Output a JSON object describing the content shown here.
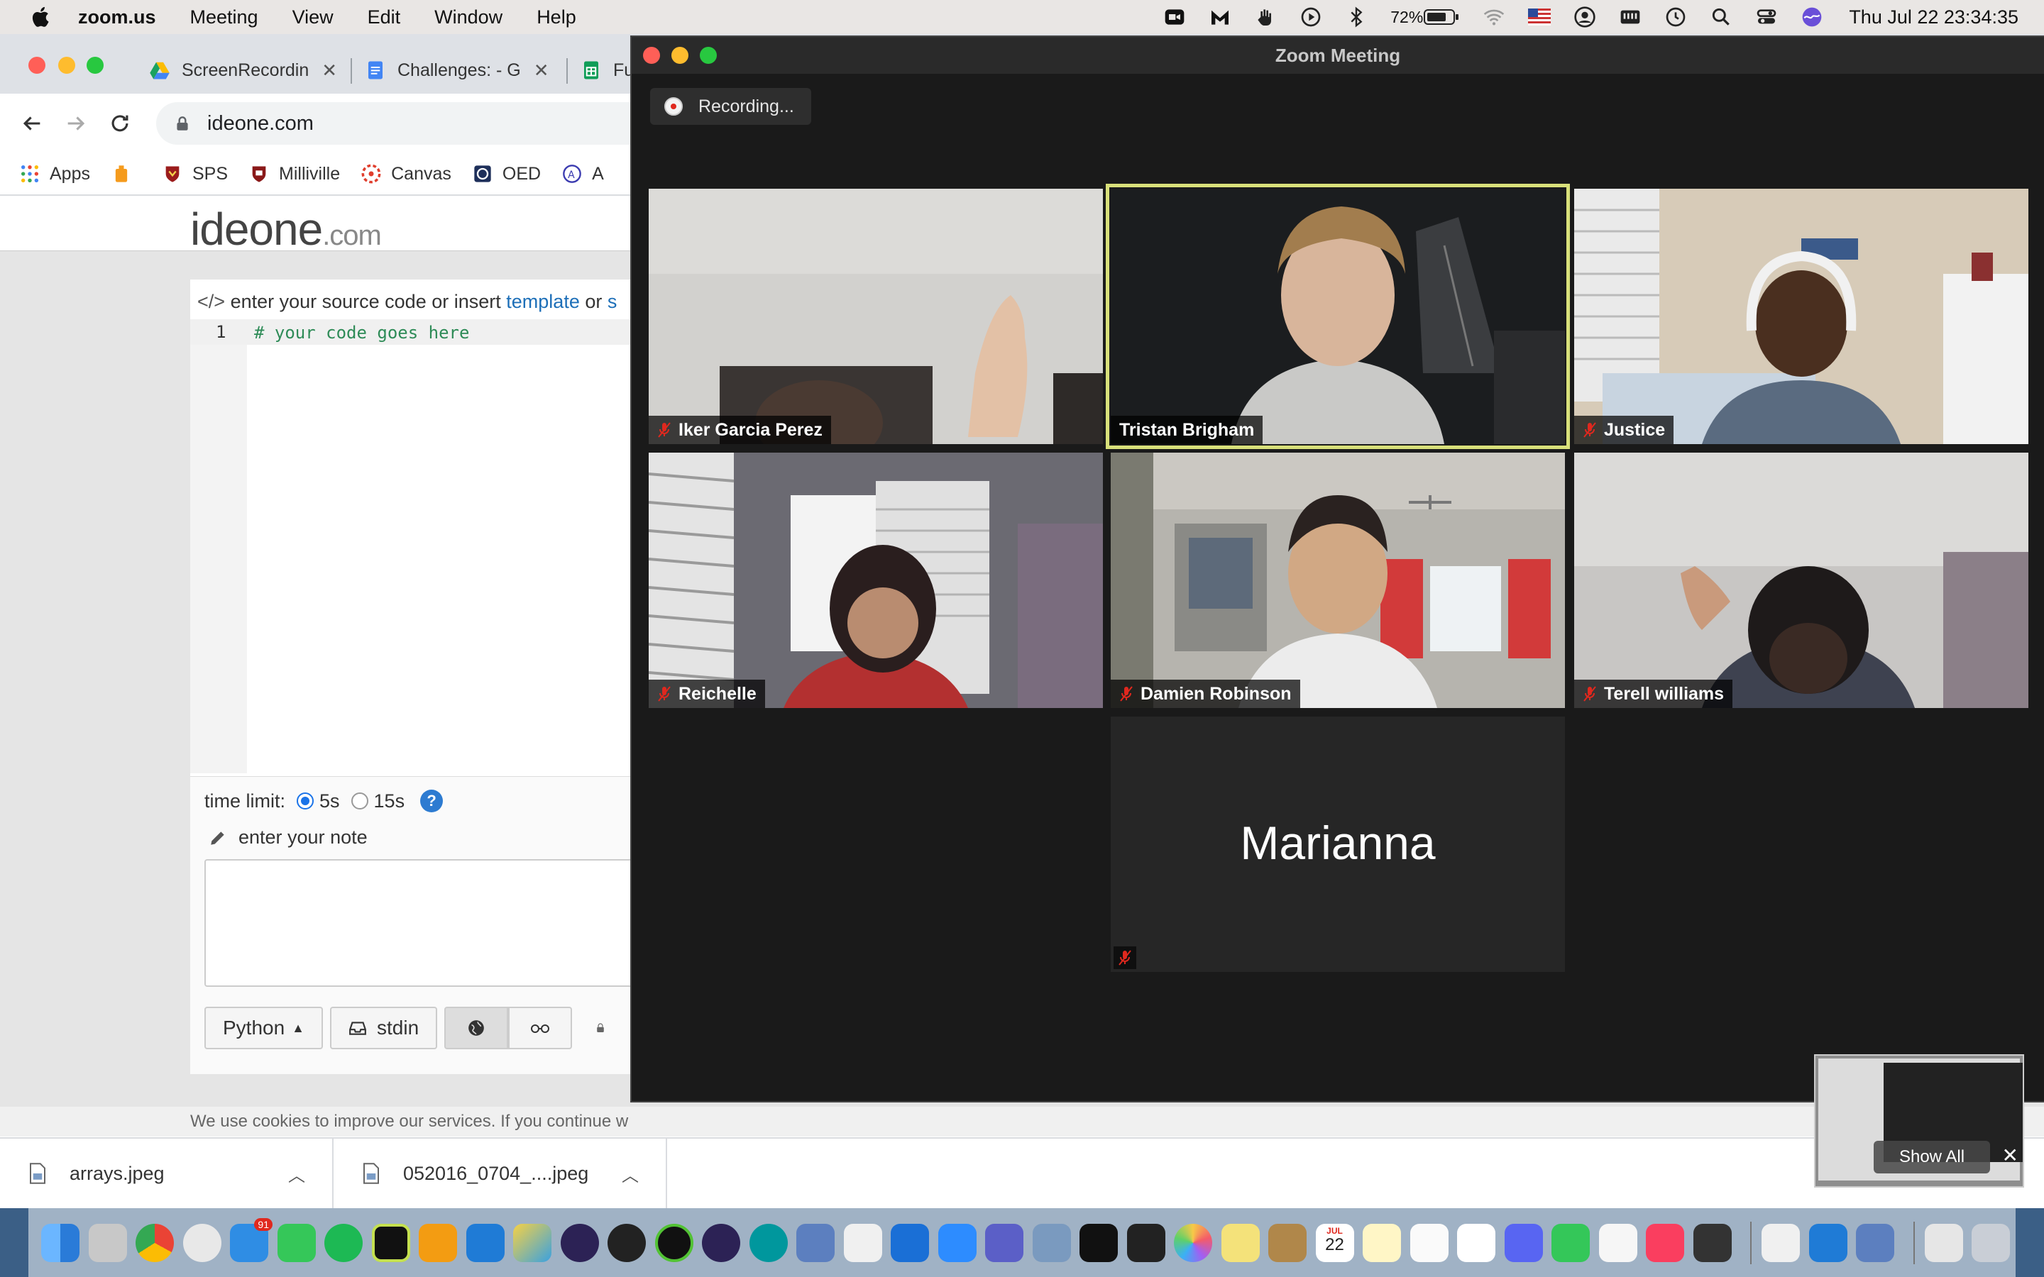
{
  "menubar": {
    "app_name": "zoom.us",
    "menus": [
      "Meeting",
      "View",
      "Edit",
      "Window",
      "Help"
    ],
    "battery_percent": "72%",
    "clock": "Thu Jul 22  23:34:35"
  },
  "browser": {
    "tabs": [
      {
        "title": "ScreenRecordin",
        "icon": "google-drive-icon"
      },
      {
        "title": "Challenges: - G",
        "icon": "google-docs-icon"
      },
      {
        "title": "Fu",
        "icon": "google-sheets-icon"
      }
    ],
    "url": "ideone.com",
    "bookmarks": [
      "Apps",
      "",
      "SPS",
      "Milliville",
      "Canvas",
      "OED",
      "A"
    ]
  },
  "ideone": {
    "logo_main": "ideone",
    "logo_suffix": ".com",
    "editor_hint_prefix": "enter your source code or insert",
    "editor_hint_link": "template",
    "editor_hint_or": "or",
    "editor_hint_tail": "s",
    "line_number": "1",
    "code_line": "# your code goes here",
    "time_limit_label": "time limit:",
    "time_limit_options": [
      "5s",
      "15s"
    ],
    "time_limit_selected": "5s",
    "note_placeholder": "enter your note",
    "language_button": "Python",
    "stdin_button": "stdin",
    "cookie_text": "We use cookies to improve our services. If you continue w"
  },
  "downloads": [
    {
      "filename": "arrays.jpeg"
    },
    {
      "filename": "052016_0704_....jpeg"
    }
  ],
  "zoom": {
    "window_title": "Zoom Meeting",
    "recording_label": "Recording...",
    "participants": [
      {
        "name": "Iker Garcia Perez",
        "muted": true,
        "active": false
      },
      {
        "name": "Tristan Brigham",
        "muted": false,
        "active": true
      },
      {
        "name": "Justice",
        "muted": true,
        "active": false
      },
      {
        "name": "Reichelle",
        "muted": true,
        "active": false
      },
      {
        "name": "Damien Robinson",
        "muted": true,
        "active": false
      },
      {
        "name": "Terell williams",
        "muted": true,
        "active": false
      },
      {
        "name": "Marianna",
        "muted": true,
        "active": false
      }
    ],
    "show_all_label": "Show All"
  },
  "dock": {
    "calendar_month": "JUL",
    "calendar_day": "22",
    "mail_badge": "91"
  },
  "colors": {
    "zoom_active_speaker": "#d8e07a",
    "mute_red": "#e0281e",
    "ideone_link": "#1d6fb8"
  }
}
